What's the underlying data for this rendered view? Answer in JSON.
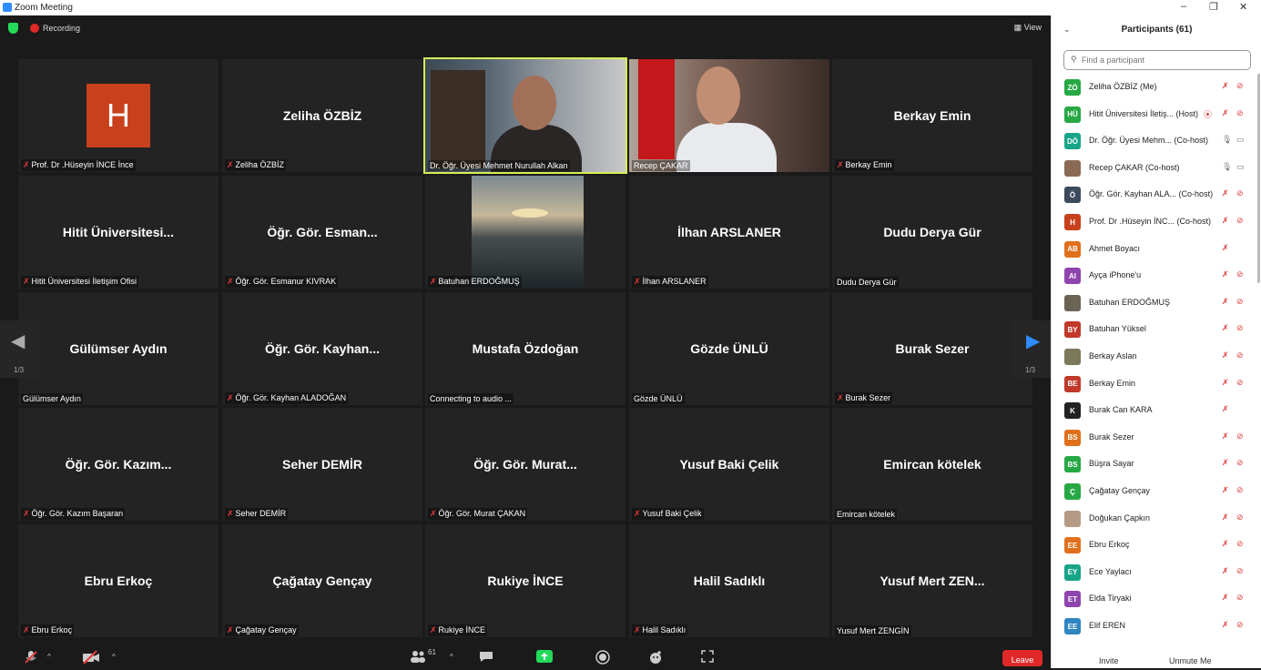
{
  "window": {
    "title": "Zoom Meeting",
    "minimize": "–",
    "restore": "❐",
    "close": "✕"
  },
  "topbar": {
    "recording": "Recording",
    "view": "▦ View"
  },
  "tiles": [
    {
      "name": "",
      "label": "Prof. Dr .Hüseyin İNCE İnce",
      "muted": true,
      "type": "logo",
      "logo_letter": "H"
    },
    {
      "name": "Zeliha ÖZBİZ",
      "label": "Zeliha ÖZBİZ",
      "muted": true,
      "type": "name"
    },
    {
      "name": "",
      "label": "Dr. Öğr. Üyesi Mehmet Nurullah Alkan",
      "muted": false,
      "type": "video1",
      "active": true
    },
    {
      "name": "",
      "label": "Recep ÇAKAR",
      "muted": false,
      "type": "video2"
    },
    {
      "name": "Berkay Emin",
      "label": "Berkay Emin",
      "muted": true,
      "type": "name"
    },
    {
      "name": "Hitit Üniversitesi...",
      "label": "Hitit Üniversitesi İletişim Ofisi",
      "muted": true,
      "type": "name"
    },
    {
      "name": "Öğr. Gör. Esman...",
      "label": "Öğr. Gör. Esmanur KIVRAK",
      "muted": true,
      "type": "name"
    },
    {
      "name": "",
      "label": "Batuhan ERDOĞMUŞ",
      "muted": true,
      "type": "video3"
    },
    {
      "name": "İlhan ARSLANER",
      "label": "İlhan ARSLANER",
      "muted": true,
      "type": "name"
    },
    {
      "name": "Dudu Derya Gür",
      "label": "Dudu Derya Gür",
      "muted": false,
      "type": "name"
    },
    {
      "name": "Gülümser Aydın",
      "label": "Gülümser Aydın",
      "muted": false,
      "type": "name"
    },
    {
      "name": "Öğr. Gör. Kayhan...",
      "label": "Öğr. Gör. Kayhan ALADOĞAN",
      "muted": true,
      "type": "name"
    },
    {
      "name": "Mustafa Özdoğan",
      "label": "Connecting to audio ...",
      "muted": false,
      "type": "name"
    },
    {
      "name": "Gözde ÜNLÜ",
      "label": "Gözde ÜNLÜ",
      "muted": false,
      "type": "name"
    },
    {
      "name": "Burak Sezer",
      "label": "Burak Sezer",
      "muted": true,
      "type": "name"
    },
    {
      "name": "Öğr. Gör. Kazım...",
      "label": "Öğr. Gör. Kazım Başaran",
      "muted": true,
      "type": "name"
    },
    {
      "name": "Seher DEMİR",
      "label": "Seher DEMİR",
      "muted": true,
      "type": "name"
    },
    {
      "name": "Öğr. Gör. Murat...",
      "label": "Öğr. Gör. Murat ÇAKAN",
      "muted": true,
      "type": "name"
    },
    {
      "name": "Yusuf Baki Çelik",
      "label": "Yusuf Baki Çelik",
      "muted": true,
      "type": "name"
    },
    {
      "name": "Emircan kötelek",
      "label": "Emircan kötelek",
      "muted": false,
      "type": "name"
    },
    {
      "name": "Ebru Erkoç",
      "label": "Ebru Erkoç",
      "muted": true,
      "type": "name"
    },
    {
      "name": "Çağatay Gençay",
      "label": "Çağatay Gençay",
      "muted": true,
      "type": "name"
    },
    {
      "name": "Rukiye İNCE",
      "label": "Rukiye İNCE",
      "muted": true,
      "type": "name"
    },
    {
      "name": "Halil Sadıklı",
      "label": "Halil Sadıklı",
      "muted": true,
      "type": "name"
    },
    {
      "name": "Yusuf Mert ZEN...",
      "label": "Yusuf Mert ZENGİN",
      "muted": false,
      "type": "name"
    }
  ],
  "pager": {
    "left_page": "1/3",
    "right_page": "1/3",
    "left_arrow": "◀",
    "right_arrow": "▶"
  },
  "toolbar": {
    "participants_count": "61",
    "leave": "Leave"
  },
  "panel": {
    "title": "Participants (61)",
    "search_placeholder": "Find a participant",
    "invite": "Invite",
    "unmute_me": "Unmute Me",
    "participants": [
      {
        "initials": "ZÖ",
        "color": "#27a844",
        "name": "Zeliha ÖZBİZ (Me)",
        "mic": "muted",
        "video": "off"
      },
      {
        "initials": "HÜ",
        "color": "#27a844",
        "name": "Hitit Üniversitesi İletiş... (Host)",
        "mic": "muted",
        "video": "off",
        "rec": true
      },
      {
        "initials": "DÖ",
        "color": "#17a589",
        "name": "Dr. Öğr. Üyesi Mehm... (Co-host)",
        "mic": "on",
        "video": "on"
      },
      {
        "initials": "",
        "color": "#8a6a55",
        "name": "Recep ÇAKAR (Co-host)",
        "mic": "on",
        "video": "on"
      },
      {
        "initials": "Ö",
        "color": "#3b4a5c",
        "name": "Öğr. Gör. Kayhan ALA... (Co-host)",
        "mic": "muted",
        "video": "off"
      },
      {
        "initials": "H",
        "color": "#c8401c",
        "name": "Prof. Dr .Hüseyin İNC... (Co-host)",
        "mic": "muted",
        "video": "off"
      },
      {
        "initials": "AB",
        "color": "#e0701c",
        "name": "Ahmet Boyacı",
        "mic": "muted",
        "video": "none"
      },
      {
        "initials": "AI",
        "color": "#8e44ad",
        "name": "Ayça iPhone'u",
        "mic": "muted",
        "video": "off"
      },
      {
        "initials": "",
        "color": "#6b6455",
        "name": "Batuhan ERDOĞMUŞ",
        "mic": "muted",
        "video": "off"
      },
      {
        "initials": "BY",
        "color": "#c0392b",
        "name": "Batuhan Yüksel",
        "mic": "muted",
        "video": "off"
      },
      {
        "initials": "",
        "color": "#7a7a5a",
        "name": "Berkay Aslan",
        "mic": "muted",
        "video": "off"
      },
      {
        "initials": "BE",
        "color": "#c0392b",
        "name": "Berkay Emin",
        "mic": "muted",
        "video": "off"
      },
      {
        "initials": "K",
        "color": "#222222",
        "name": "Burak Can KARA",
        "mic": "muted",
        "video": "none"
      },
      {
        "initials": "BS",
        "color": "#e0701c",
        "name": "Burak Sezer",
        "mic": "muted",
        "video": "off"
      },
      {
        "initials": "BS",
        "color": "#27a844",
        "name": "Büşra Sayar",
        "mic": "muted",
        "video": "off"
      },
      {
        "initials": "Ç",
        "color": "#27a844",
        "name": "Çağatay Gençay",
        "mic": "muted",
        "video": "off"
      },
      {
        "initials": "",
        "color": "#b59a85",
        "name": "Doğukan Çapkın",
        "mic": "muted",
        "video": "off"
      },
      {
        "initials": "EE",
        "color": "#e0701c",
        "name": "Ebru Erkoç",
        "mic": "muted",
        "video": "off"
      },
      {
        "initials": "EY",
        "color": "#17a589",
        "name": "Ece Yaylacı",
        "mic": "muted",
        "video": "off"
      },
      {
        "initials": "ET",
        "color": "#8e44ad",
        "name": "Elda Tiryaki",
        "mic": "muted",
        "video": "off"
      },
      {
        "initials": "EE",
        "color": "#2e86c1",
        "name": "Elif EREN",
        "mic": "muted",
        "video": "off"
      }
    ]
  }
}
